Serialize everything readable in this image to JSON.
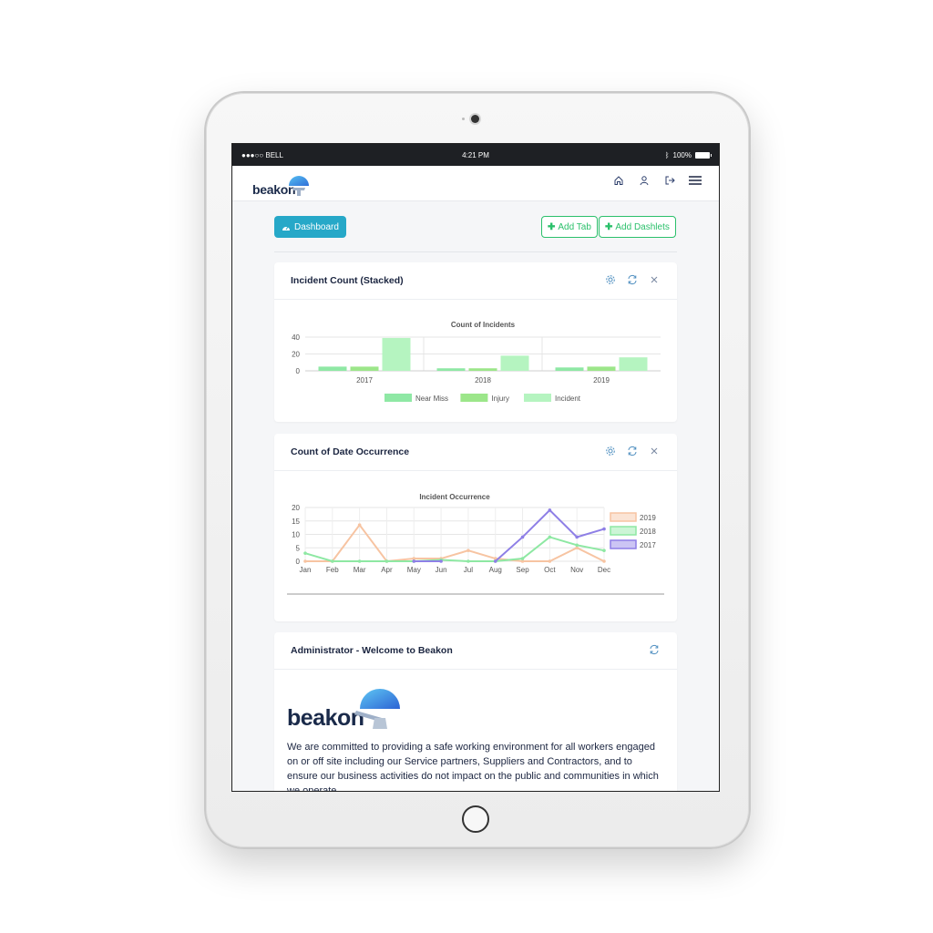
{
  "status_bar": {
    "carrier": "●●●○○ BELL",
    "time": "4:21 PM",
    "battery": "100%"
  },
  "app": {
    "logo": "beakon"
  },
  "toolbar": {
    "dashboard_label": "Dashboard",
    "add_tab_label": "Add Tab",
    "add_dashlets_label": "Add Dashlets"
  },
  "colors": {
    "accent": "#26a8c8",
    "green": "#2bc06b"
  },
  "cards": {
    "incident": {
      "title": "Incident Count (Stacked)"
    },
    "occurrence": {
      "title": "Count of Date Occurrence"
    },
    "welcome": {
      "title": "Administrator - Welcome to Beakon",
      "logo": "beakon",
      "text": "We are committed to providing a safe working environment for all workers engaged on or off site including our Service partners, Suppliers and Contractors, and to ensure our business activities do not impact on the public and communities in which we operate."
    }
  },
  "chart_data": [
    {
      "type": "bar",
      "title": "Count of Incidents",
      "categories": [
        "2017",
        "2018",
        "2019"
      ],
      "ylim": [
        0,
        40
      ],
      "yticks": [
        0,
        20,
        40
      ],
      "series": [
        {
          "name": "Near Miss",
          "color": "#8fe8a5",
          "values": [
            5,
            3,
            4
          ]
        },
        {
          "name": "Injury",
          "color": "#9ce68a",
          "values": [
            5,
            3,
            5
          ]
        },
        {
          "name": "Incident",
          "color": "#b5f4c0",
          "values": [
            39,
            18,
            16
          ]
        }
      ],
      "legend": "bottom"
    },
    {
      "type": "line",
      "title": "Incident Occurrence",
      "categories": [
        "Jan",
        "Feb",
        "Mar",
        "Apr",
        "May",
        "Jun",
        "Jul",
        "Aug",
        "Sep",
        "Oct",
        "Nov",
        "Dec"
      ],
      "ylim": [
        0,
        20
      ],
      "yticks": [
        0,
        5,
        10,
        15,
        20
      ],
      "series": [
        {
          "name": "2019",
          "color": "#f7c4a2",
          "values": [
            0,
            0,
            13.5,
            0,
            1,
            1,
            4,
            1,
            0,
            0,
            5,
            0
          ]
        },
        {
          "name": "2018",
          "color": "#8ee8a3",
          "values": [
            3,
            0,
            0,
            0,
            0,
            0.5,
            0,
            0,
            1,
            9,
            6,
            4
          ]
        },
        {
          "name": "2017",
          "color": "#8e7fe6",
          "values": [
            null,
            null,
            null,
            null,
            0,
            0,
            null,
            0,
            9,
            19,
            9,
            12
          ]
        }
      ],
      "legend": "right"
    }
  ]
}
